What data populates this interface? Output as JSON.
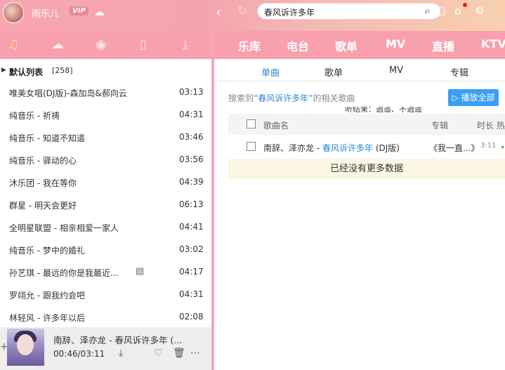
{
  "header": {
    "username": "雨乐儿",
    "vip_label": "VIP",
    "search_value": "春风诉许多年"
  },
  "left_tabs": [
    "music-note-icon",
    "cloud-icon",
    "radio-icon",
    "device-icon",
    "download-icon"
  ],
  "playlist": {
    "name": "默认列表",
    "count": "[258]",
    "songs": [
      {
        "title": "唯美女唱(DJ版)-森加岛&郝向云",
        "duration": "03:13"
      },
      {
        "title": "纯音乐 - 祈祷",
        "duration": "04:31"
      },
      {
        "title": "纯音乐 - 知道不知道",
        "duration": "03:46"
      },
      {
        "title": "纯音乐 - 驿动的心",
        "duration": "03:56"
      },
      {
        "title": "沐乐团 - 我在等你",
        "duration": "04:39"
      },
      {
        "title": "群星 - 明天会更好",
        "duration": "06:13"
      },
      {
        "title": "全明星联盟 - 相亲相爱一家人",
        "duration": "04:41"
      },
      {
        "title": "纯音乐 - 梦中的婚礼",
        "duration": "03:02"
      },
      {
        "title": "孙艺琪 - 最远的你是我最近...",
        "duration": "04:17"
      },
      {
        "title": "罗翊允 - 跟我约会吧",
        "duration": "04:31"
      },
      {
        "title": "林轻风 - 许多年以后",
        "duration": "02:08"
      }
    ]
  },
  "player": {
    "now_playing": "南辞、泽亦龙 - 春风诉许多年 (...",
    "time": "00:46/03:11"
  },
  "right_nav": [
    "乐库",
    "电台",
    "歌单",
    "MV",
    "直播",
    "KTV"
  ],
  "sub_tabs": [
    "单曲",
    "歌单",
    "MV",
    "专辑"
  ],
  "results": {
    "prefix": "搜索到",
    "query": "“春风诉许多年”",
    "suffix": "的相关歌曲",
    "play_all": "▷ 播放全部",
    "hint": "听结果：逍遥、不逍遥",
    "col_song": "歌曲名",
    "col_album": "专辑",
    "col_duration": "时长 热",
    "track": {
      "artist": "南辞、泽亦龙",
      "sep": " - ",
      "song": "春风诉许多年",
      "suffix": " (DJ版)",
      "album": "《我一直...》",
      "duration": "3:11"
    },
    "no_more": "已经没有更多数据"
  }
}
